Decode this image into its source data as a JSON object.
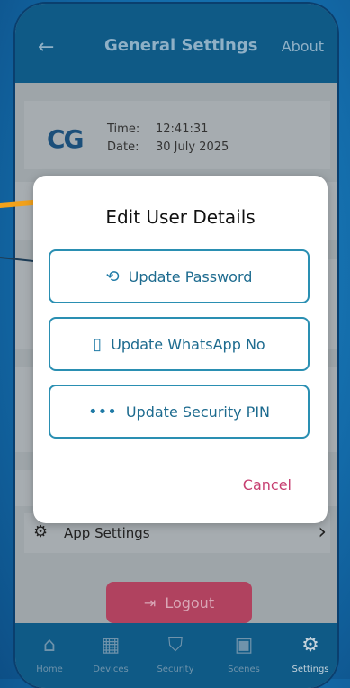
{
  "header": {
    "back_icon": "arrow-left-icon",
    "title": "General Settings",
    "about": "About"
  },
  "info": {
    "logo_text": "CG",
    "time_label": "Time:",
    "time_value": "12:41:31",
    "date_label": "Date:",
    "date_value": "30 July 2025"
  },
  "app_settings": {
    "label": "App Settings"
  },
  "logout": {
    "label": "Logout"
  },
  "nav": [
    {
      "label": "Home"
    },
    {
      "label": "Devices"
    },
    {
      "label": "Security"
    },
    {
      "label": "Scenes"
    },
    {
      "label": "Settings"
    }
  ],
  "modal": {
    "title": "Edit User Details",
    "buttons": [
      {
        "label": "Update Password"
      },
      {
        "label": "Update WhatsApp No"
      },
      {
        "label": "Update Security PIN"
      }
    ],
    "cancel": "Cancel"
  },
  "colors": {
    "accent": "#2a8fb2",
    "cancel": "#c73f71",
    "bar": "#0f5a86",
    "logout": "#b0425f"
  }
}
